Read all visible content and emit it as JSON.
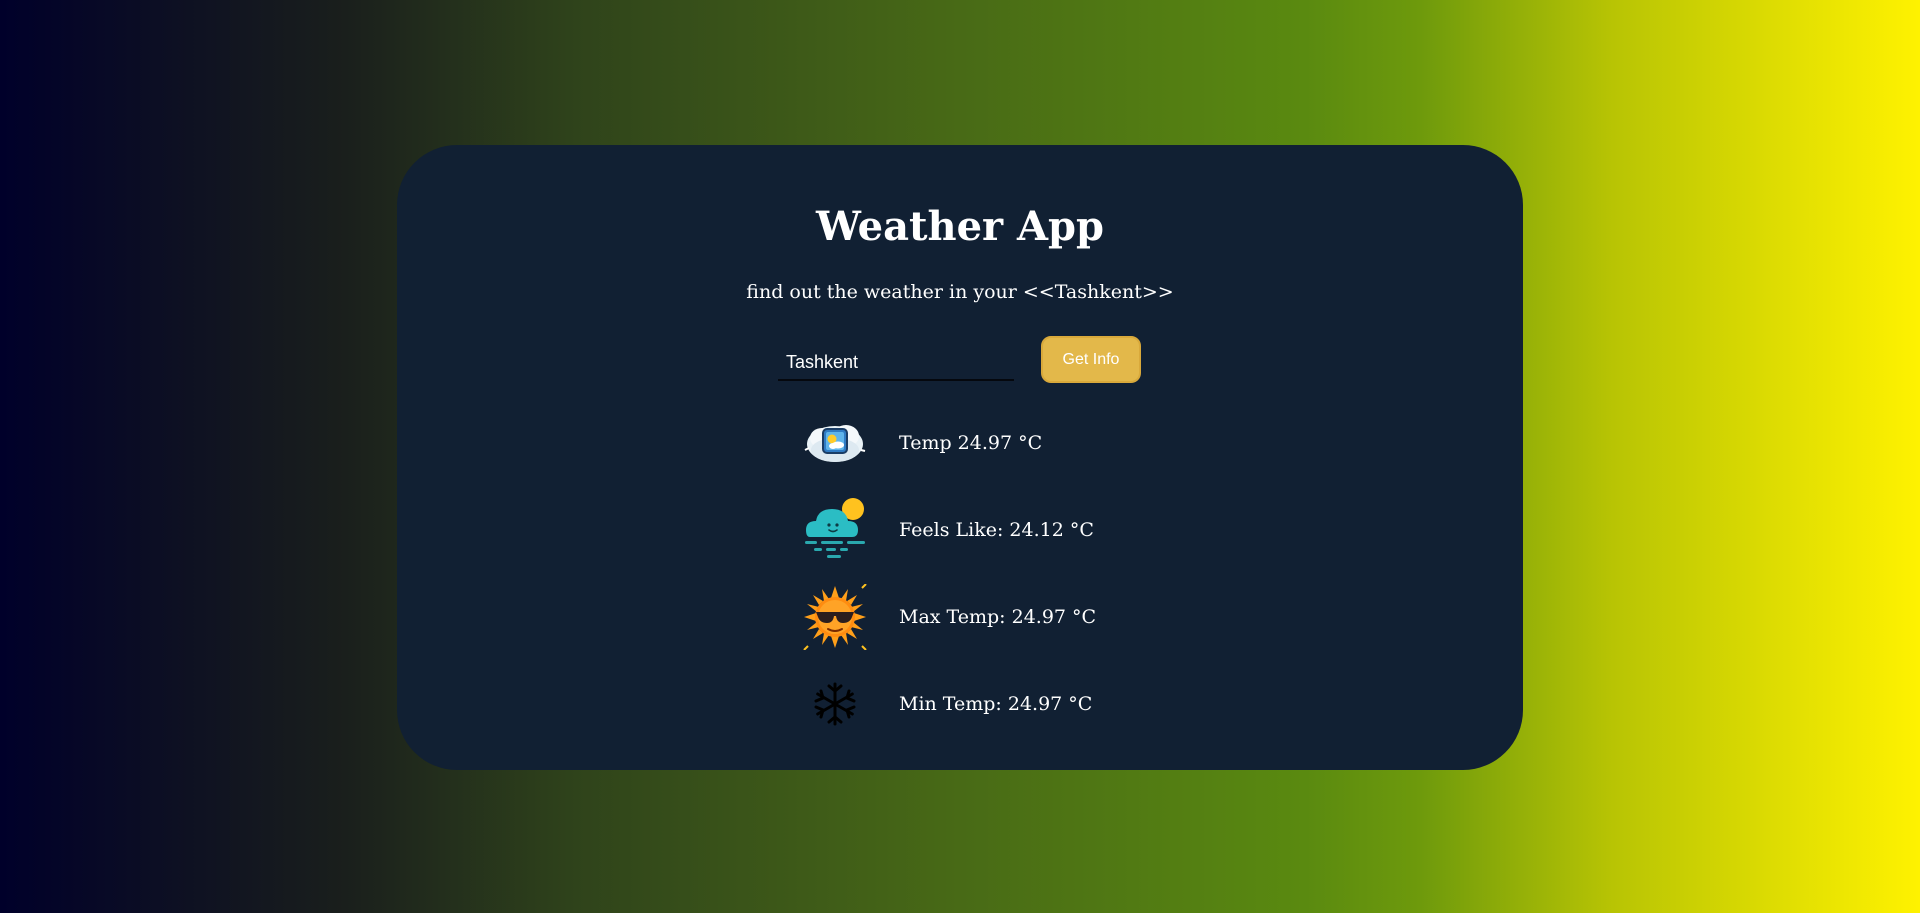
{
  "app": {
    "title": "Weather App",
    "subtitle": "find out the weather in your <<Tashkent>>"
  },
  "search": {
    "value": "Tashkent",
    "button_label": "Get Info"
  },
  "stats": [
    {
      "label": "Temp 24.97 °C",
      "icon": "weather-photo-icon"
    },
    {
      "label": "Feels Like: 24.12 °C",
      "icon": "cloud-fog-sun-icon"
    },
    {
      "label": "Max Temp: 24.97 °C",
      "icon": "sun-sunglasses-icon"
    },
    {
      "label": "Min Temp: 24.97 °C",
      "icon": "snowflake-icon"
    }
  ],
  "colors": {
    "card_background": "#112033",
    "button": "#e3b84a",
    "gradient_start": "#00002a",
    "gradient_end": "#fff200"
  }
}
